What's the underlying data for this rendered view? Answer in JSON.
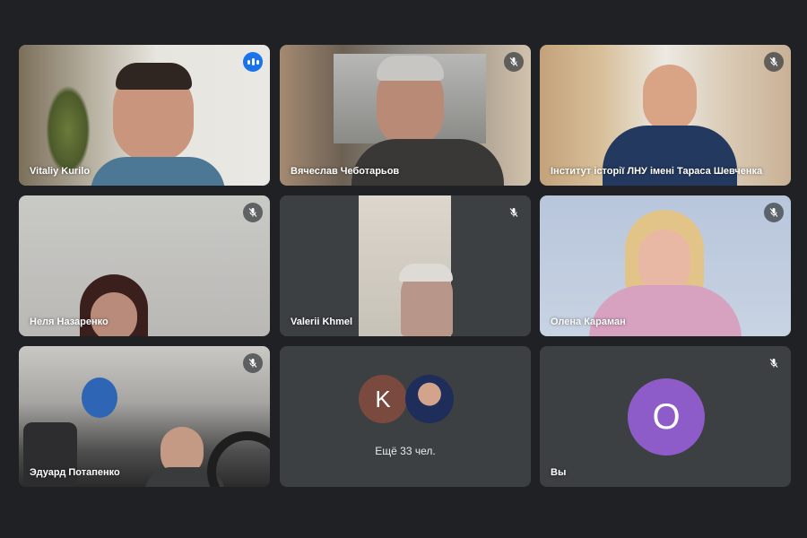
{
  "tiles": [
    {
      "name": "Vitaliy Kurilo",
      "status": "speaking"
    },
    {
      "name": "Вячеслав Чеботарьов",
      "status": "muted"
    },
    {
      "name": "Інститут історії ЛНУ імені Тараса Шевченка",
      "status": "muted"
    },
    {
      "name": "Неля Назаренко",
      "status": "muted"
    },
    {
      "name": "Valerii Khmel",
      "status": "muted"
    },
    {
      "name": "Олена Караман",
      "status": "muted"
    },
    {
      "name": "Эдуард Потапенко",
      "status": "muted"
    }
  ],
  "overflow": {
    "initial": "K",
    "label": "Ещё 33 чел.",
    "avatar_color": "#7a4a3f"
  },
  "self": {
    "initial": "O",
    "name": "Вы",
    "avatar_color": "#8e5cc9",
    "status": "muted"
  },
  "colors": {
    "background": "#202124",
    "active_border": "#8ab4f8",
    "speaking": "#1a73e8"
  },
  "icons": {
    "muted": "mic-off-icon",
    "speaking": "audio-level-icon"
  }
}
